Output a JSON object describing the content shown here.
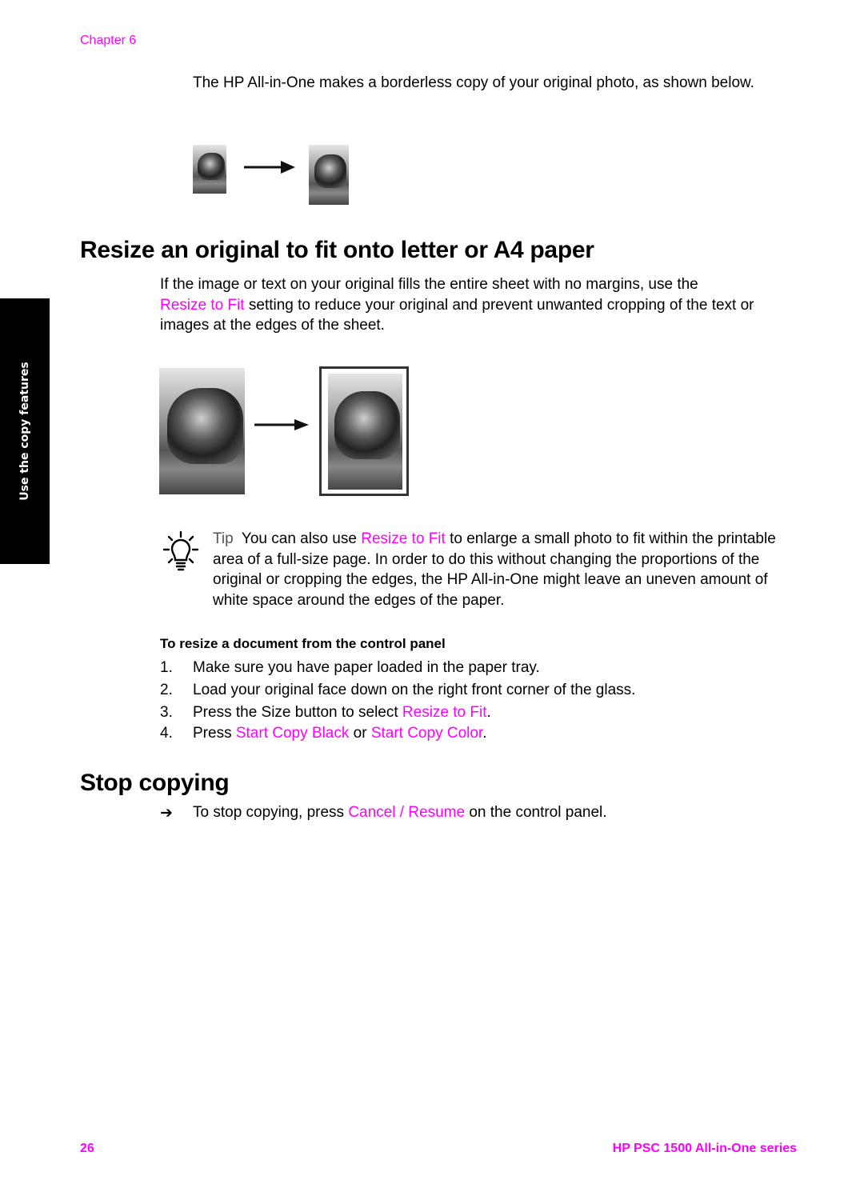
{
  "header": {
    "chapter": "Chapter 6"
  },
  "intro": {
    "text": "The HP All-in-One makes a borderless copy of your original photo, as shown below."
  },
  "figures": {
    "borderless": {
      "original_alt": "tiger-photo-original",
      "copy_alt": "tiger-photo-borderless-copy",
      "arrow": "right-arrow"
    },
    "resize": {
      "original_alt": "tiger-photo-full-bleed",
      "copy_alt": "tiger-photo-resized-on-page",
      "arrow": "right-arrow"
    }
  },
  "section_resize": {
    "title": "Resize an original to fit onto letter or A4 paper",
    "para_pre": "If the image or text on your original fills the entire sheet with no margins, use the",
    "para_highlight": "Resize to Fit",
    "para_post": " setting to reduce your original and prevent unwanted cropping of the text or images at the edges of the sheet."
  },
  "tip": {
    "icon": "lightbulb-icon",
    "label": "Tip",
    "pre": "  You can also use ",
    "highlight": "Resize to Fit",
    "post": " to enlarge a small photo to fit within the printable area of a full-size page. In order to do this without changing the proportions of the original or cropping the edges, the HP All-in-One might leave an uneven amount of white space around the edges of the paper."
  },
  "procedure": {
    "heading": "To resize a document from the control panel",
    "steps": [
      {
        "num": "1.",
        "text": "Make sure you have paper loaded in the paper tray."
      },
      {
        "num": "2.",
        "text": "Load your original face down on the right front corner of the glass."
      },
      {
        "num": "3.",
        "pre": "Press the Size button to select ",
        "hl": "Resize to Fit",
        "post": "."
      },
      {
        "num": "4.",
        "pre": "Press ",
        "hl1": "Start Copy Black",
        "mid": " or ",
        "hl2": "Start Copy Color",
        "post": "."
      }
    ]
  },
  "section_stop": {
    "title": "Stop copying",
    "arrow": "➔",
    "pre": "To stop copying, press ",
    "highlight": "Cancel / Resume",
    "post": " on the control panel."
  },
  "side_tab": {
    "label": "Use the copy features"
  },
  "footer": {
    "page_number": "26",
    "title": "HP PSC 1500 All-in-One series"
  },
  "colors": {
    "accent": "#ff00ff",
    "text": "#000000",
    "side_tab_bg": "#000000"
  }
}
